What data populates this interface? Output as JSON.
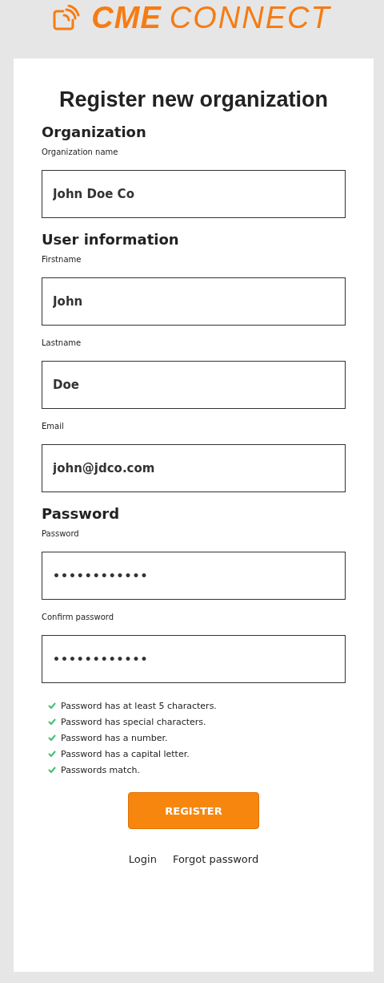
{
  "logo": {
    "brand": "CME",
    "product": "CONNECT"
  },
  "title": "Register new organization",
  "sections": [
    {
      "heading": "Organization",
      "fields": [
        {
          "label": "Organization name",
          "value": "John Doe Co",
          "kind": "text"
        }
      ]
    },
    {
      "heading": "User information",
      "fields": [
        {
          "label": "Firstname",
          "value": "John",
          "kind": "text"
        },
        {
          "label": "Lastname",
          "value": "Doe",
          "kind": "text"
        },
        {
          "label": "Email",
          "value": "john@jdco.com",
          "kind": "text"
        }
      ]
    },
    {
      "heading": "Password",
      "fields": [
        {
          "label": "Password",
          "value": "••••••••••••",
          "kind": "password"
        },
        {
          "label": "Confirm password",
          "value": "••••••••••••",
          "kind": "password"
        }
      ]
    }
  ],
  "rules": [
    {
      "text": "Password has at least 5 characters.",
      "met": true
    },
    {
      "text": "Password has special characters.",
      "met": true
    },
    {
      "text": "Password has a number.",
      "met": true
    },
    {
      "text": "Password has a capital letter.",
      "met": true
    },
    {
      "text": "Passwords match.",
      "met": true
    }
  ],
  "register_button": "REGISTER",
  "links": [
    "Login",
    "Forgot password"
  ]
}
